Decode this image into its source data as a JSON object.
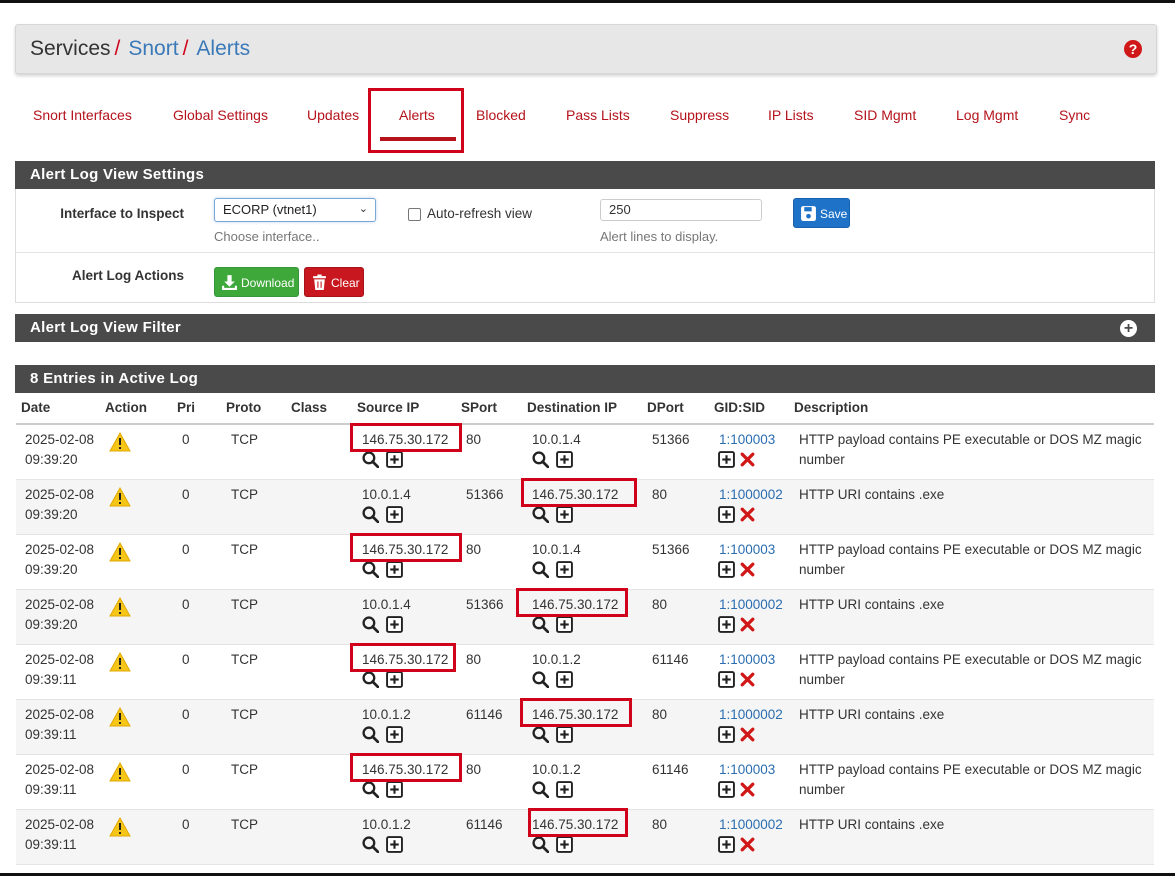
{
  "breadcrumb": {
    "root": "Services",
    "sep": "/",
    "item1": "Snort",
    "item2": "Alerts"
  },
  "help_icon": "question-circle-icon",
  "tabs": [
    {
      "label": "Snort Interfaces"
    },
    {
      "label": "Global Settings"
    },
    {
      "label": "Updates"
    },
    {
      "label": "Alerts"
    },
    {
      "label": "Blocked"
    },
    {
      "label": "Pass Lists"
    },
    {
      "label": "Suppress"
    },
    {
      "label": "IP Lists"
    },
    {
      "label": "SID Mgmt"
    },
    {
      "label": "Log Mgmt"
    },
    {
      "label": "Sync"
    }
  ],
  "settings": {
    "title": "Alert Log View Settings",
    "interface_label": "Interface to Inspect",
    "interface_value": "ECORP (vtnet1)",
    "interface_help": "Choose interface..",
    "autorefresh_label": "Auto-refresh view",
    "lines_value": "250",
    "lines_help": "Alert lines to display.",
    "save_label": "Save",
    "actions_label": "Alert Log Actions",
    "download_label": "Download",
    "clear_label": "Clear"
  },
  "filter": {
    "title": "Alert Log View Filter"
  },
  "log": {
    "title": "8 Entries in Active Log",
    "columns": [
      "Date",
      "Action",
      "Pri",
      "Proto",
      "Class",
      "Source IP",
      "SPort",
      "Destination IP",
      "DPort",
      "GID:SID",
      "Description"
    ],
    "rows": [
      {
        "date": "2025-02-08",
        "time": "09:39:20",
        "pri": "0",
        "proto": "TCP",
        "class": "",
        "src": "146.75.30.172",
        "sport": "80",
        "dst": "10.0.1.4",
        "dport": "51366",
        "gidsid": "1:100003",
        "desc1": "HTTP payload contains PE executable or DOS MZ magic",
        "desc2": "number"
      },
      {
        "date": "2025-02-08",
        "time": "09:39:20",
        "pri": "0",
        "proto": "TCP",
        "class": "",
        "src": "10.0.1.4",
        "sport": "51366",
        "dst": "146.75.30.172",
        "dport": "80",
        "gidsid": "1:1000002",
        "desc1": "HTTP URI contains .exe",
        "desc2": ""
      },
      {
        "date": "2025-02-08",
        "time": "09:39:20",
        "pri": "0",
        "proto": "TCP",
        "class": "",
        "src": "146.75.30.172",
        "sport": "80",
        "dst": "10.0.1.4",
        "dport": "51366",
        "gidsid": "1:100003",
        "desc1": "HTTP payload contains PE executable or DOS MZ magic",
        "desc2": "number"
      },
      {
        "date": "2025-02-08",
        "time": "09:39:20",
        "pri": "0",
        "proto": "TCP",
        "class": "",
        "src": "10.0.1.4",
        "sport": "51366",
        "dst": "146.75.30.172",
        "dport": "80",
        "gidsid": "1:1000002",
        "desc1": "HTTP URI contains .exe",
        "desc2": ""
      },
      {
        "date": "2025-02-08",
        "time": "09:39:11",
        "pri": "0",
        "proto": "TCP",
        "class": "",
        "src": "146.75.30.172",
        "sport": "80",
        "dst": "10.0.1.2",
        "dport": "61146",
        "gidsid": "1:100003",
        "desc1": "HTTP payload contains PE executable or DOS MZ magic",
        "desc2": "number"
      },
      {
        "date": "2025-02-08",
        "time": "09:39:11",
        "pri": "0",
        "proto": "TCP",
        "class": "",
        "src": "10.0.1.2",
        "sport": "61146",
        "dst": "146.75.30.172",
        "dport": "80",
        "gidsid": "1:1000002",
        "desc1": "HTTP URI contains .exe",
        "desc2": ""
      },
      {
        "date": "2025-02-08",
        "time": "09:39:11",
        "pri": "0",
        "proto": "TCP",
        "class": "",
        "src": "146.75.30.172",
        "sport": "80",
        "dst": "10.0.1.2",
        "dport": "61146",
        "gidsid": "1:100003",
        "desc1": "HTTP payload contains PE executable or DOS MZ magic",
        "desc2": "number"
      },
      {
        "date": "2025-02-08",
        "time": "09:39:11",
        "pri": "0",
        "proto": "TCP",
        "class": "",
        "src": "10.0.1.2",
        "sport": "61146",
        "dst": "146.75.30.172",
        "dport": "80",
        "gidsid": "1:1000002",
        "desc1": "HTTP URI contains .exe",
        "desc2": ""
      }
    ]
  },
  "colors": {
    "accent_red": "#b5121b",
    "link_blue": "#3b7ab8",
    "panel_dark": "#4a4a4a",
    "highlight": "#d0021b"
  }
}
